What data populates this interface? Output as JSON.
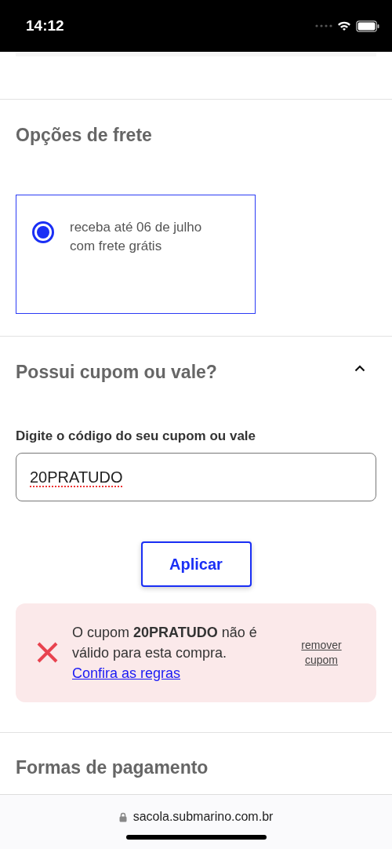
{
  "status_bar": {
    "time": "14:12"
  },
  "shipping": {
    "title": "Opções de frete",
    "options": [
      {
        "label": "receba até 06 de julho com frete grátis",
        "selected": true
      }
    ]
  },
  "coupon": {
    "title": "Possui cupom ou vale?",
    "expanded": true,
    "field_label": "Digite o código do seu cupom ou vale",
    "value": "20PRATUDO",
    "apply_button": "Aplicar",
    "error": {
      "message": "O cupom **20PRATUDO** não é válido para esta compra.",
      "link": "Confira as regras",
      "remove": "remover cupom"
    }
  },
  "payment": {
    "title": "Formas de pagamento"
  },
  "browser": {
    "url": "sacola.submarino.com.br"
  }
}
